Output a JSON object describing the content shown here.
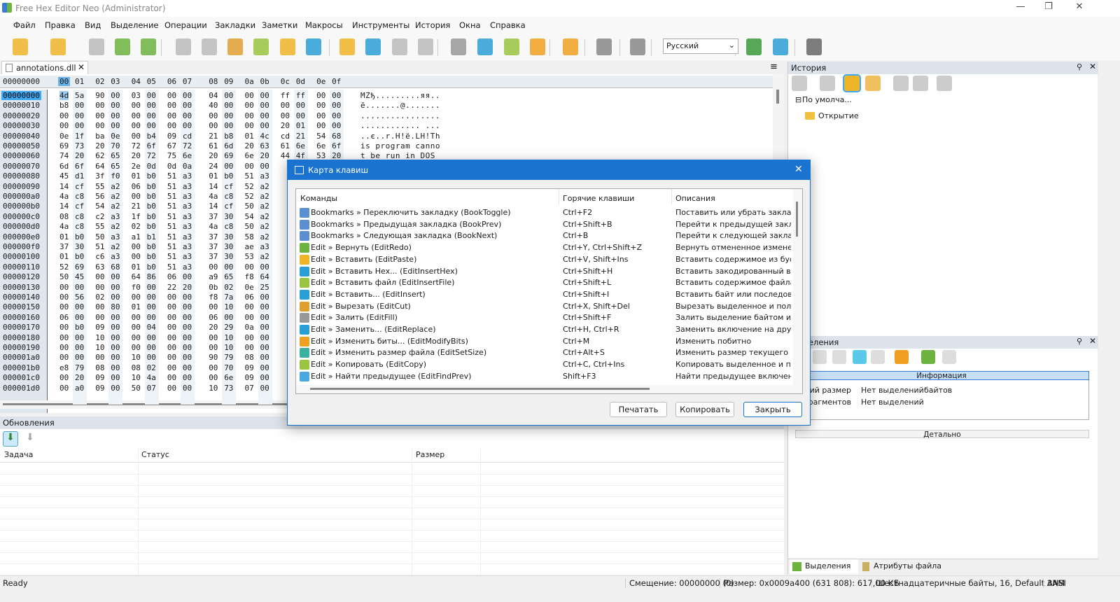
{
  "window": {
    "title": "Free Hex Editor Neo (Administrator)",
    "controls": [
      "—",
      "❐",
      "✕"
    ]
  },
  "menu": [
    "Файл",
    "Правка",
    "Вид",
    "Выделение",
    "Операции",
    "Закладки",
    "Заметки",
    "Макросы",
    "Инструменты",
    "История",
    "Окна",
    "Справка"
  ],
  "toolbar": {
    "language": "Русский",
    "icons": [
      "new-file-icon",
      "open-file-icon",
      "save-icon",
      "save-as-icon",
      "save-all-icon",
      "undo-icon",
      "redo-icon",
      "cut-icon",
      "copy-icon",
      "paste-icon",
      "erase-icon",
      "insert-icon",
      "find-icon",
      "find-prev-icon",
      "find-next-icon",
      "fill-icon",
      "replace-icon",
      "insert-file-icon",
      "bits-icon",
      "select-all-icon",
      "fgv-icon",
      "split-icon",
      "language-icon",
      "web-icon",
      "web-update-icon",
      "tools-icon"
    ]
  },
  "editor": {
    "tab": "annotations.dll",
    "header_offset": "00000000",
    "header_cols": [
      "00",
      "01",
      "02",
      "03",
      "04",
      "05",
      "06",
      "07",
      "08",
      "09",
      "0a",
      "0b",
      "0c",
      "0d",
      "0e",
      "0f"
    ],
    "rows": [
      {
        "off": "00000000",
        "bytes": "4d 5a 90 00 03 00 00 00 04 00 00 00 ff ff 00 00",
        "ascii": "MZђ.........яя.."
      },
      {
        "off": "00000010",
        "bytes": "b8 00 00 00 00 00 00 00 40 00 00 00 00 00 00 00",
        "ascii": "ё.......@......."
      },
      {
        "off": "00000020",
        "bytes": "00 00 00 00 00 00 00 00 00 00 00 00 00 00 00 00",
        "ascii": "................"
      },
      {
        "off": "00000030",
        "bytes": "00 00 00 00 00 00 00 00 00 00 00 00 20 01 00 00",
        "ascii": "............ ..."
      },
      {
        "off": "00000040",
        "bytes": "0e 1f ba 0e 00 b4 09 cd 21 b8 01 4c cd 21 54 68",
        "ascii": "..є..r.H!ё.LH!Th"
      },
      {
        "off": "00000050",
        "bytes": "69 73 20 70 72 6f 67 72 61 6d 20 63 61 6e 6e 6f",
        "ascii": "is program canno"
      },
      {
        "off": "00000060",
        "bytes": "74 20 62 65 20 72 75 6e 20 69 6e 20 44 4f 53 20",
        "ascii": "t be run in DOS "
      },
      {
        "off": "00000070",
        "bytes": "6d 6f 64 65 2e 0d 0d 0a 24 00 00 00"
      },
      {
        "off": "00000080",
        "bytes": "45 d1 3f f0 01 b0 51 a3 01 b0 51 a3"
      },
      {
        "off": "00000090",
        "bytes": "14 cf 55 a2 06 b0 51 a3 14 cf 52 a2"
      },
      {
        "off": "000000a0",
        "bytes": "4a c8 56 a2 00 b0 51 a3 4a c8 52 a2"
      },
      {
        "off": "000000b0",
        "bytes": "14 cf 54 a2 21 b0 51 a3 14 cf 50 a2"
      },
      {
        "off": "000000c0",
        "bytes": "08 c8 c2 a3 1f b0 51 a3 37 30 54 a2"
      },
      {
        "off": "000000d0",
        "bytes": "4a c8 55 a2 02 b0 51 a3 4a c8 50 a2"
      },
      {
        "off": "000000e0",
        "bytes": "01 b0 50 a3 a1 b1 51 a3 37 30 58 a2"
      },
      {
        "off": "000000f0",
        "bytes": "37 30 51 a2 00 b0 51 a3 37 30 ae a3"
      },
      {
        "off": "00000100",
        "bytes": "01 b0 c6 a3 00 b0 51 a3 37 30 53 a2"
      },
      {
        "off": "00000110",
        "bytes": "52 69 63 68 01 b0 51 a3 00 00 00 00"
      },
      {
        "off": "00000120",
        "bytes": "50 45 00 00 64 86 06 00 a9 65 f8 64"
      },
      {
        "off": "00000130",
        "bytes": "00 00 00 00 f0 00 22 20 0b 02 0e 25"
      },
      {
        "off": "00000140",
        "bytes": "00 56 02 00 00 00 00 00 f8 7a 06 00"
      },
      {
        "off": "00000150",
        "bytes": "00 00 00 80 01 00 00 00 00 10 00 00"
      },
      {
        "off": "00000160",
        "bytes": "06 00 00 00 00 00 00 00 06 00 00 00"
      },
      {
        "off": "00000170",
        "bytes": "00 b0 09 00 00 04 00 00 20 29 0a 00"
      },
      {
        "off": "00000180",
        "bytes": "00 00 10 00 00 00 00 00 00 10 00 00"
      },
      {
        "off": "00000190",
        "bytes": "00 00 10 00 00 00 00 00 00 10 00 00"
      },
      {
        "off": "000001a0",
        "bytes": "00 00 00 00 10 00 00 00 90 79 08 00"
      },
      {
        "off": "000001b0",
        "bytes": "e8 79 08 00 08 02 00 00 00 70 09 00"
      },
      {
        "off": "000001c0",
        "bytes": "00 20 09 00 10 4a 00 00 00 6e 09 00"
      },
      {
        "off": "000001d0",
        "bytes": "00 a0 09 00 50 07 00 00 10 73 07 00"
      }
    ]
  },
  "updates": {
    "title": "Обновления",
    "columns": [
      "Задача",
      "Статус",
      "Размер"
    ]
  },
  "history": {
    "title": "История",
    "tree": [
      "По умолча...",
      "Открытие"
    ]
  },
  "selections": {
    "title": "Выделения",
    "info": "Информация",
    "rows": [
      [
        "Общий размер",
        "Нет выделений",
        "байтов"
      ],
      [
        "Фрагментов",
        "Нет выделений",
        ""
      ]
    ],
    "detail": "Детально",
    "tabs": [
      "Выделения",
      "Атрибуты файла"
    ]
  },
  "status": {
    "ready": "Ready",
    "offset": "Смещение: 00000000 (0)",
    "size": "Размер: 0x0009a400 (631 808): 617,00 КБ",
    "mode": "Шестнадцатеричные байты, 16, Default ANSI",
    "ins": "ЗАМ"
  },
  "dialog": {
    "title": "Карта клавиш",
    "columns": [
      "Команды",
      "Горячие клавиши",
      "Описания"
    ],
    "rows": [
      {
        "cmd": "Bookmarks » Переключить закладку (BookToggle)",
        "key": "Ctrl+F2",
        "desc": "Поставить или убрать закладку",
        "icon": "bookmark-toggle-icon",
        "color": "#5a8fd0"
      },
      {
        "cmd": "Bookmarks » Предыдущая закладка (BookPrev)",
        "key": "Ctrl+Shift+B",
        "desc": "Перейти к предыдущей закладк",
        "icon": "bookmark-prev-icon",
        "color": "#5a8fd0"
      },
      {
        "cmd": "Bookmarks » Следующая закладка (BookNext)",
        "key": "Ctrl+B",
        "desc": "Перейти к следующей закладке",
        "icon": "bookmark-next-icon",
        "color": "#5a8fd0"
      },
      {
        "cmd": "Edit » Вернуть (EditRedo)",
        "key": "Ctrl+Y, Ctrl+Shift+Z",
        "desc": "Вернуть отмененное изменение",
        "icon": "redo-icon",
        "color": "#6cb33f"
      },
      {
        "cmd": "Edit » Вставить (EditPaste)",
        "key": "Ctrl+V, Shift+Ins",
        "desc": "Вставить содержимое из буфера",
        "icon": "paste-icon",
        "color": "#f0b429"
      },
      {
        "cmd": "Edit » Вставить Hex... (EditInsertHex)",
        "key": "Ctrl+Shift+H",
        "desc": "Вставить закодированный в ASC",
        "icon": "insert-hex-icon",
        "color": "#2a9fd6"
      },
      {
        "cmd": "Edit » Вставить файл (EditInsertFile)",
        "key": "Ctrl+Shift+L",
        "desc": "Вставить содержимое файла с те",
        "icon": "insert-file-icon",
        "color": "#9ac340"
      },
      {
        "cmd": "Edit » Вставить... (EditInsert)",
        "key": "Ctrl+Shift+I",
        "desc": "Вставить байт или последовател",
        "icon": "insert-icon",
        "color": "#2a9fd6"
      },
      {
        "cmd": "Edit » Вырезать (EditCut)",
        "key": "Ctrl+X, Shift+Del",
        "desc": "Вырезать выделенное и положи",
        "icon": "cut-icon",
        "color": "#e0a030"
      },
      {
        "cmd": "Edit » Залить (EditFill)",
        "key": "Ctrl+Shift+F",
        "desc": "Залить выделение байтом или п",
        "icon": "fill-icon",
        "color": "#999999"
      },
      {
        "cmd": "Edit » Заменить... (EditReplace)",
        "key": "Ctrl+H, Ctrl+R",
        "desc": "Заменить включение на другое",
        "icon": "replace-icon",
        "color": "#2a9fd6"
      },
      {
        "cmd": "Edit » Изменить биты... (EditModifyBits)",
        "key": "Ctrl+M",
        "desc": "Изменить побитно",
        "icon": "bits-icon",
        "color": "#f0a020"
      },
      {
        "cmd": "Edit » Изменить размер файла (EditSetSize)",
        "key": "Ctrl+Alt+S",
        "desc": "Изменить размер текущего файл",
        "icon": "resize-icon",
        "color": "#3ab0a0"
      },
      {
        "cmd": "Edit » Копировать (EditCopy)",
        "key": "Ctrl+C, Ctrl+Ins",
        "desc": "Копировать выделенное и полож",
        "icon": "copy-icon",
        "color": "#9ac340"
      },
      {
        "cmd": "Edit » Найти предыдущее (EditFindPrev)",
        "key": "Shift+F3",
        "desc": "Найти предыдущее включение",
        "icon": "find-prev-icon",
        "color": "#4aa8e0"
      }
    ],
    "buttons": {
      "print": "Печатать",
      "copy": "Копировать",
      "close": "Закрыть"
    }
  }
}
